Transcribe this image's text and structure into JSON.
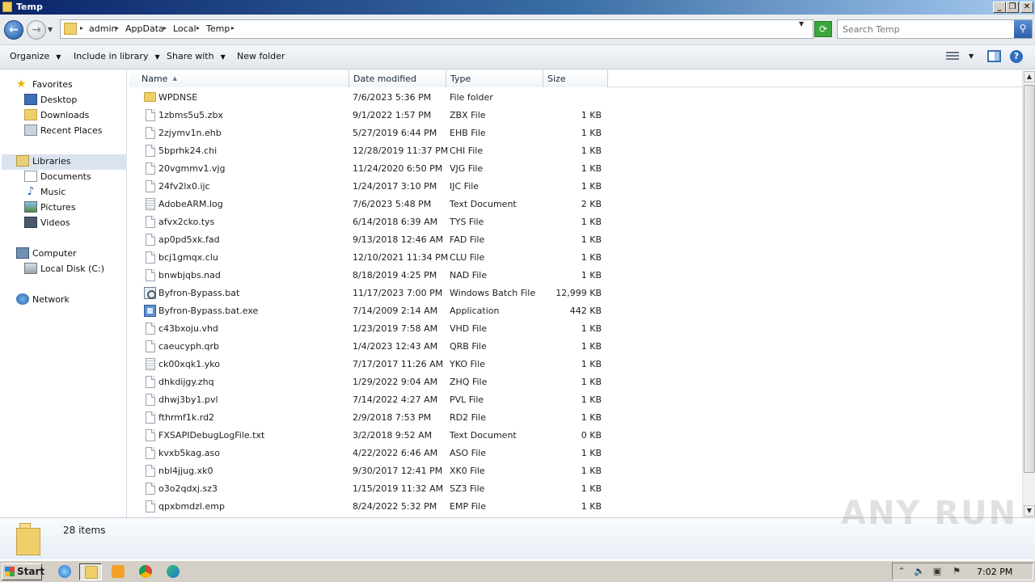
{
  "window": {
    "title": "Temp"
  },
  "address": {
    "crumbs": [
      "admin",
      "AppData",
      "Local",
      "Temp"
    ]
  },
  "search": {
    "placeholder": "Search Temp"
  },
  "toolbar": {
    "organize": "Organize",
    "include": "Include in library",
    "share": "Share with",
    "new_folder": "New folder"
  },
  "nav": {
    "favorites": "Favorites",
    "desktop": "Desktop",
    "downloads": "Downloads",
    "recent": "Recent Places",
    "libraries": "Libraries",
    "documents": "Documents",
    "music": "Music",
    "pictures": "Pictures",
    "videos": "Videos",
    "computer": "Computer",
    "local_disk": "Local Disk (C:)",
    "network": "Network"
  },
  "columns": {
    "name": "Name",
    "date": "Date modified",
    "type": "Type",
    "size": "Size"
  },
  "files": [
    {
      "name": "WPDNSE",
      "date": "7/6/2023 5:36 PM",
      "type": "File folder",
      "size": "",
      "icon": "folder-icon"
    },
    {
      "name": "1zbms5u5.zbx",
      "date": "9/1/2022 1:57 PM",
      "type": "ZBX File",
      "size": "1 KB",
      "icon": "file-icon"
    },
    {
      "name": "2zjymv1n.ehb",
      "date": "5/27/2019 6:44 PM",
      "type": "EHB File",
      "size": "1 KB",
      "icon": "file-icon"
    },
    {
      "name": "5bprhk24.chi",
      "date": "12/28/2019 11:37 PM",
      "type": "CHI File",
      "size": "1 KB",
      "icon": "file-icon"
    },
    {
      "name": "20vgmmv1.vjg",
      "date": "11/24/2020 6:50 PM",
      "type": "VJG File",
      "size": "1 KB",
      "icon": "file-icon"
    },
    {
      "name": "24fv2lx0.ijc",
      "date": "1/24/2017 3:10 PM",
      "type": "IJC File",
      "size": "1 KB",
      "icon": "file-icon"
    },
    {
      "name": "AdobeARM.log",
      "date": "7/6/2023 5:48 PM",
      "type": "Text Document",
      "size": "2 KB",
      "icon": "text-file-icon"
    },
    {
      "name": "afvx2cko.tys",
      "date": "6/14/2018 6:39 AM",
      "type": "TYS File",
      "size": "1 KB",
      "icon": "file-icon"
    },
    {
      "name": "ap0pd5xk.fad",
      "date": "9/13/2018 12:46 AM",
      "type": "FAD File",
      "size": "1 KB",
      "icon": "file-icon"
    },
    {
      "name": "bcj1gmqx.clu",
      "date": "12/10/2021 11:34 PM",
      "type": "CLU File",
      "size": "1 KB",
      "icon": "file-icon"
    },
    {
      "name": "bnwbjqbs.nad",
      "date": "8/18/2019 4:25 PM",
      "type": "NAD File",
      "size": "1 KB",
      "icon": "file-icon"
    },
    {
      "name": "Byfron-Bypass.bat",
      "date": "11/17/2023 7:00 PM",
      "type": "Windows Batch File",
      "size": "12,999 KB",
      "icon": "batch-file-icon"
    },
    {
      "name": "Byfron-Bypass.bat.exe",
      "date": "7/14/2009 2:14 AM",
      "type": "Application",
      "size": "442 KB",
      "icon": "application-icon"
    },
    {
      "name": "c43bxoju.vhd",
      "date": "1/23/2019 7:58 AM",
      "type": "VHD File",
      "size": "1 KB",
      "icon": "file-icon"
    },
    {
      "name": "caeucyph.qrb",
      "date": "1/4/2023 12:43 AM",
      "type": "QRB File",
      "size": "1 KB",
      "icon": "file-icon"
    },
    {
      "name": "ck00xqk1.yko",
      "date": "7/17/2017 11:26 AM",
      "type": "YKO File",
      "size": "1 KB",
      "icon": "text-file-icon"
    },
    {
      "name": "dhkdijgy.zhq",
      "date": "1/29/2022 9:04 AM",
      "type": "ZHQ File",
      "size": "1 KB",
      "icon": "file-icon"
    },
    {
      "name": "dhwj3by1.pvl",
      "date": "7/14/2022 4:27 AM",
      "type": "PVL File",
      "size": "1 KB",
      "icon": "file-icon"
    },
    {
      "name": "fthrmf1k.rd2",
      "date": "2/9/2018 7:53 PM",
      "type": "RD2 File",
      "size": "1 KB",
      "icon": "file-icon"
    },
    {
      "name": "FXSAPIDebugLogFile.txt",
      "date": "3/2/2018 9:52 AM",
      "type": "Text Document",
      "size": "0 KB",
      "icon": "file-icon"
    },
    {
      "name": "kvxb5kag.aso",
      "date": "4/22/2022 6:46 AM",
      "type": "ASO File",
      "size": "1 KB",
      "icon": "file-icon"
    },
    {
      "name": "nbl4jjug.xk0",
      "date": "9/30/2017 12:41 PM",
      "type": "XK0 File",
      "size": "1 KB",
      "icon": "file-icon"
    },
    {
      "name": "o3o2qdxj.sz3",
      "date": "1/15/2019 11:32 AM",
      "type": "SZ3 File",
      "size": "1 KB",
      "icon": "file-icon"
    },
    {
      "name": "qpxbmdzl.emp",
      "date": "8/24/2022 5:32 PM",
      "type": "EMP File",
      "size": "1 KB",
      "icon": "file-icon"
    }
  ],
  "status": {
    "item_count": "28 items"
  },
  "taskbar": {
    "start": "Start",
    "clock": "7:02 PM",
    "apps": [
      "internet-explorer-icon",
      "explorer-icon",
      "media-player-icon",
      "chrome-icon",
      "edge-icon"
    ]
  },
  "watermark": "ANY RUN",
  "colors": {
    "title_start": "#0a246a",
    "title_end": "#a6caf0",
    "selected_nav": "#dbe4ee"
  }
}
